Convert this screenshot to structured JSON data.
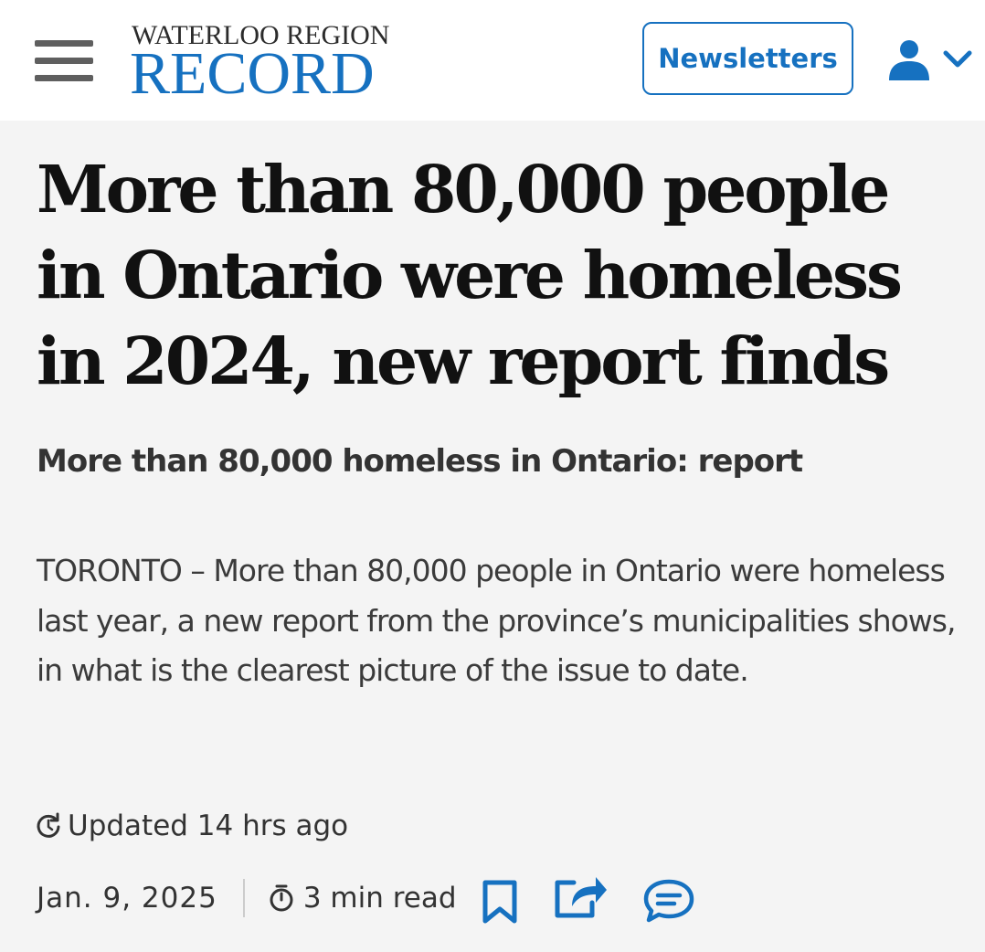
{
  "header": {
    "logo_top": "WATERLOO REGION",
    "logo_main": "RECORD",
    "newsletters_label": "Newsletters",
    "brand_color": "#1671c0"
  },
  "article": {
    "headline": "More than 80,000 people in Ontario were homeless in 2024, new report finds",
    "subhead": "More than 80,000 homeless in Ontario: report",
    "lede": "TORONTO – More than 80,000 people in Ontario were homeless last year, a new report from the province’s municipalities shows, in what is the clearest picture of the issue to date.",
    "updated": "Updated 14 hrs ago",
    "date": "Jan. 9, 2025",
    "read_time": "3 min read"
  },
  "icons": [
    "menu-icon",
    "account-icon",
    "chevron-down-icon",
    "refresh-icon",
    "stopwatch-icon",
    "bookmark-icon",
    "share-icon",
    "comment-icon"
  ]
}
